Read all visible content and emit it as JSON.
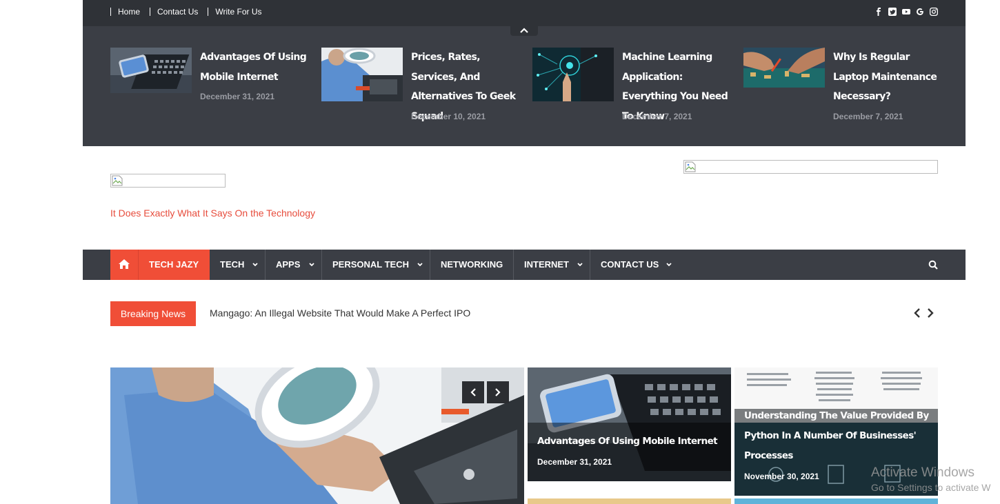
{
  "top_links": [
    "Home",
    "Contact Us",
    "Write For Us"
  ],
  "social_icons": [
    "facebook-icon",
    "twitter-icon",
    "youtube-icon",
    "google-icon",
    "instagram-icon"
  ],
  "top_posts": [
    {
      "title": "Advantages Of Using Mobile Internet",
      "date": "December 31, 2021"
    },
    {
      "title": "Prices, Rates, Services, And Alternatives To Geek Squad",
      "date": "December 10, 2021"
    },
    {
      "title": "Machine Learning Application: Everything You Need To Know",
      "date": "December 7, 2021"
    },
    {
      "title": "Why Is Regular Laptop Maintenance Necessary?",
      "date": "December 7, 2021"
    }
  ],
  "header": {
    "tagline": "It Does Exactly What It Says On the Technology"
  },
  "nav": {
    "items": [
      {
        "label": "TECH JAZY",
        "active": true
      },
      {
        "label": "TECH"
      },
      {
        "label": "APPS"
      },
      {
        "label": "PERSONAL TECH"
      },
      {
        "label": "NETWORKING"
      },
      {
        "label": "INTERNET"
      },
      {
        "label": "CONTACT US"
      }
    ]
  },
  "breaking": {
    "label": "Breaking News",
    "headline": "Mangago: An Illegal Website That Would Make A Perfect IPO"
  },
  "featured": {
    "cards": [
      {
        "title": "Advantages Of Using Mobile Internet",
        "date": "December 31, 2021"
      },
      {
        "title": "Understanding The Value Provided By Python In A Number Of Businesses' Processes",
        "date": "November 30, 2021"
      }
    ]
  },
  "watermark": {
    "line1": "Activate Windows",
    "line2": "Go to Settings to activate W"
  },
  "colors": {
    "accent": "#f04e37",
    "dark_bar": "#3b3e45",
    "tagline": "#e74c3c"
  }
}
